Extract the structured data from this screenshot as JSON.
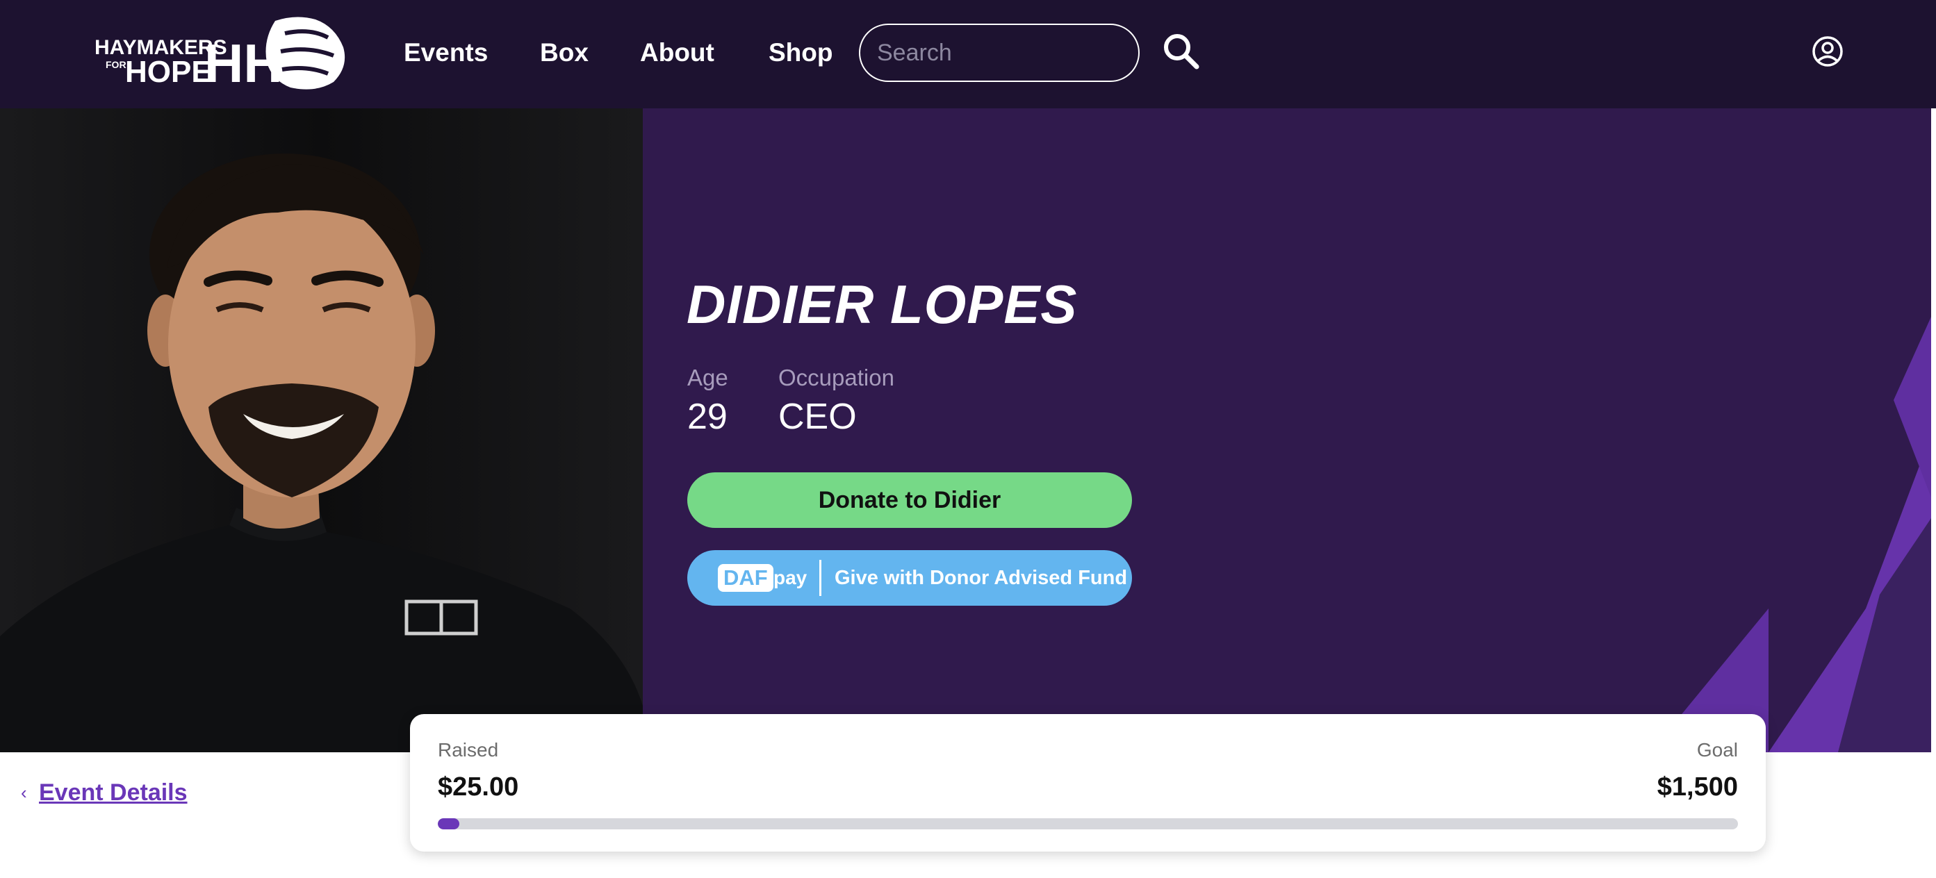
{
  "brand": {
    "logo_line1": "HAYMAKERS",
    "logo_line2": "FOR",
    "logo_line3": "HOPE",
    "logo_mark": "HH"
  },
  "nav": {
    "links": [
      "Events",
      "Box",
      "About",
      "Shop"
    ],
    "search_placeholder": "Search",
    "search_icon": "search-icon",
    "account_icon": "user-circle-icon"
  },
  "fighter": {
    "name": "DIDIER LOPES",
    "age_label": "Age",
    "age": "29",
    "occupation_label": "Occupation",
    "occupation": "CEO",
    "photo_alt": "fighter-photo"
  },
  "actions": {
    "donate_label": "Donate to Didier",
    "daf_badge": "DAF",
    "daf_pay": "pay",
    "daf_label": "Give with Donor Advised Fund"
  },
  "back_link": {
    "label": "Event Details"
  },
  "fundraising": {
    "raised_label": "Raised",
    "raised": "$25.00",
    "goal_label": "Goal",
    "goal": "$1,500",
    "progress_fraction": 0.0167
  },
  "colors": {
    "nav_bg": "#1d1230",
    "hero_bg": "#301a4d",
    "accent_purple": "#6a37b8",
    "donate_green": "#76d987",
    "daf_blue": "#63b5ef"
  }
}
